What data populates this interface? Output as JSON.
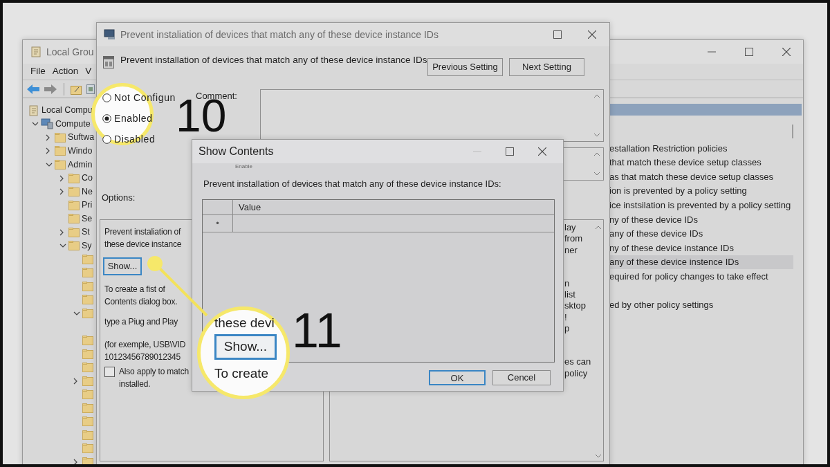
{
  "background_window": {
    "title": "Local Grou",
    "menu": [
      "File",
      "Action",
      "V"
    ],
    "tree": [
      {
        "label": "Local Compu",
        "kind": "policy",
        "children": [
          {
            "label": "Compute",
            "kind": "computer",
            "expanded": true,
            "children": [
              {
                "label": "Suftwa",
                "kind": "folder",
                "expanded": false
              },
              {
                "label": "Windo",
                "kind": "folder",
                "expanded": false
              },
              {
                "label": "Admin",
                "kind": "folder",
                "expanded": true,
                "children": [
                  {
                    "label": "Co",
                    "kind": "folder",
                    "expanded": false
                  },
                  {
                    "label": "Ne",
                    "kind": "folder",
                    "expanded": false
                  },
                  {
                    "label": "Pri",
                    "kind": "folder"
                  },
                  {
                    "label": "Se",
                    "kind": "folder"
                  },
                  {
                    "label": "St",
                    "kind": "folder",
                    "expanded": false
                  },
                  {
                    "label": "Sy",
                    "kind": "folder",
                    "expanded": true,
                    "children": [
                      {
                        "kind": "folder"
                      },
                      {
                        "kind": "folder"
                      },
                      {
                        "kind": "folder"
                      },
                      {
                        "kind": "folder"
                      },
                      {
                        "kind": "folder",
                        "expanded": true
                      },
                      {
                        "kind": "folder"
                      },
                      {
                        "kind": "folder"
                      },
                      {
                        "kind": "folder"
                      },
                      {
                        "kind": "folder",
                        "expanded": false
                      },
                      {
                        "kind": "folder"
                      },
                      {
                        "kind": "folder"
                      },
                      {
                        "kind": "folder"
                      },
                      {
                        "kind": "folder"
                      },
                      {
                        "kind": "folder"
                      },
                      {
                        "kind": "folder",
                        "expanded": false
                      }
                    ]
                  }
                ]
              }
            ]
          }
        ]
      }
    ],
    "list_items": [
      {
        "kind": "policy",
        "text": "estallation Restriction policies",
        "selected": false
      },
      {
        "kind": "policy",
        "text": "that match these device setup classes",
        "selected": false
      },
      {
        "kind": "policy",
        "text": "as that match these device setup classes",
        "selected": false
      },
      {
        "kind": "policy",
        "text": "ion is prevented by a policy setting",
        "selected": false
      },
      {
        "kind": "policy",
        "text": "ice instsilation is prevented by a policy setting",
        "selected": false
      },
      {
        "kind": "policy",
        "text": "ny of these device IDs",
        "selected": false
      },
      {
        "kind": "policy",
        "text": "any of these device IDs",
        "selected": false
      },
      {
        "kind": "policy",
        "text": "ny of these device instance IDs",
        "selected": false
      },
      {
        "kind": "policy",
        "text": "any of these device instence IDs",
        "selected": true
      },
      {
        "kind": "policy",
        "text": "equired for policy changes to take effect",
        "selected": false
      },
      {
        "kind": "blank"
      },
      {
        "kind": "policy",
        "text": "ed by other policy settings",
        "selected": false
      }
    ]
  },
  "policy_dialog": {
    "title": "Prevent instaliation of devices that match any of these device instance IDs",
    "heading": "Prevent installation of devices that match any of these device instance IDs",
    "buttons": [
      "Previous Setting",
      "Next Setting"
    ],
    "comment_label": "Comment:",
    "options_label": "Options:",
    "options_paragraphs_top": [
      [
        "Prevent instaliation of",
        "these device instance"
      ]
    ],
    "show_button": {
      "label": "Show...",
      "focused": true
    },
    "options_paragraphs": [
      [
        "To create a fist of",
        "Contents dialog box."
      ],
      [
        "type a Piug and Play"
      ],
      [
        "(for exemple, USB\\VID",
        "10123456789012345"
      ]
    ],
    "checkbox": {
      "lines": [
        "Also apply to match",
        "installed."
      ],
      "checked": false
    },
    "help_paragraphs": [
      [
        "lay",
        "from",
        "ner"
      ],
      [
        "n",
        "list",
        "sktop",
        "!",
        "p"
      ],
      [
        "es can",
        "policy"
      ]
    ]
  },
  "show_contents": {
    "title": "Show Contents",
    "subtitle": "Enable",
    "label": "Prevent installation of devices that match any of these device instance IDs:",
    "column": "Value",
    "rows": [
      {
        "marker": "•"
      }
    ],
    "buttons": [
      {
        "label": "OK",
        "default": true
      },
      {
        "label": "Cencel",
        "default": false
      }
    ]
  },
  "callouts": [
    {
      "number": "10",
      "radios": [
        {
          "label": "Not Configun",
          "selected": false
        },
        {
          "label": "Enabled",
          "selected": true
        },
        {
          "label": "Disabled",
          "selected": false
        }
      ]
    },
    {
      "number": "11",
      "text_above": "these devi",
      "button": {
        "label": "Show...",
        "focused": true
      },
      "text_below": "To create"
    }
  ]
}
